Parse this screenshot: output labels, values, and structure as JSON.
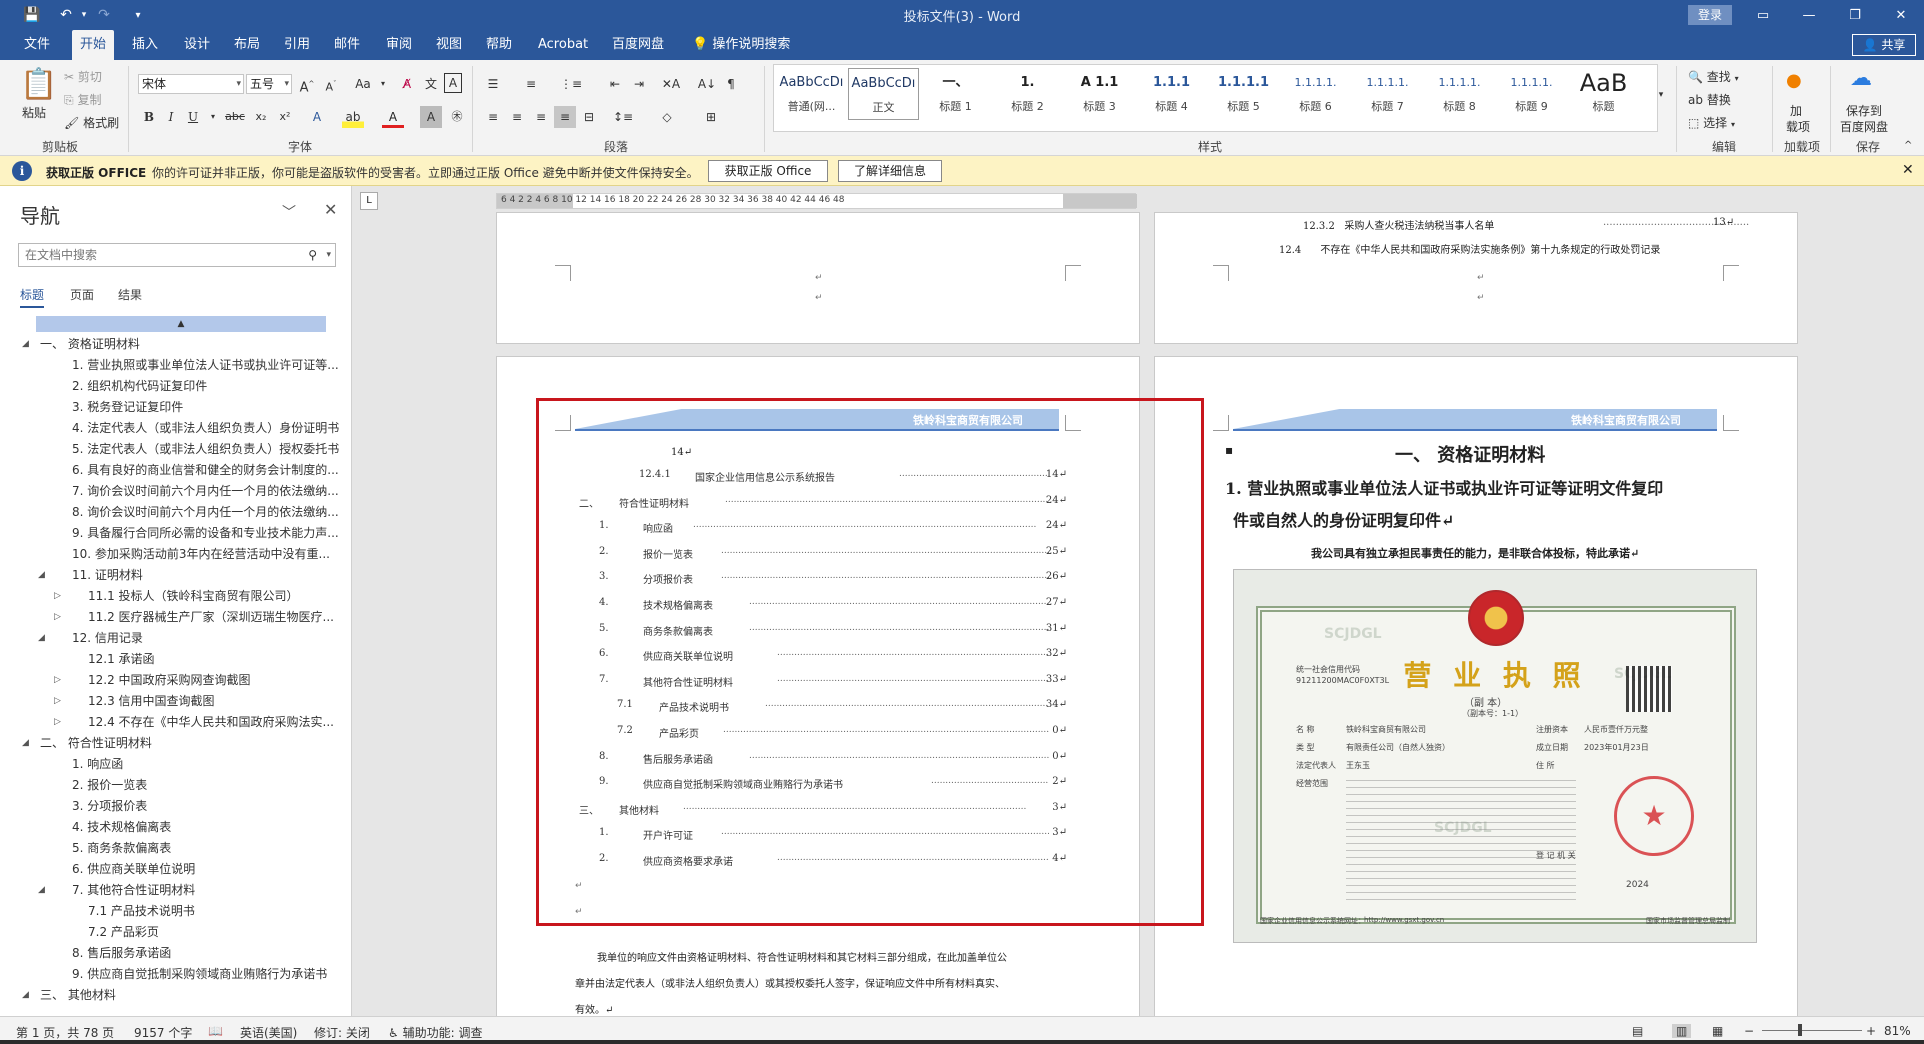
{
  "window": {
    "title": "投标文件(3)  -  Word",
    "login_label": "登录"
  },
  "tabs": [
    "文件",
    "开始",
    "插入",
    "设计",
    "布局",
    "引用",
    "邮件",
    "审阅",
    "视图",
    "帮助",
    "Acrobat",
    "百度网盘"
  ],
  "active_tab": "开始",
  "tell_me": "操作说明搜索",
  "share_label": "共享",
  "ribbon": {
    "clipboard": {
      "paste": "粘贴",
      "cut": "剪切",
      "copy": "复制",
      "format_painter": "格式刷",
      "label": "剪贴板"
    },
    "font": {
      "name": "宋体",
      "size": "五号",
      "label": "字体"
    },
    "paragraph": {
      "label": "段落"
    },
    "styles": {
      "label": "样式",
      "items": [
        {
          "sample": "AaBbCcDı",
          "name": "普通(网..."
        },
        {
          "sample": "AaBbCcDı",
          "name": "正文"
        },
        {
          "sample": "一、",
          "name": "标题 1"
        },
        {
          "sample": "1.",
          "name": "标题 2"
        },
        {
          "sample": "A 1.1",
          "name": "标题 3"
        },
        {
          "sample": "1.1.1",
          "name": "标题 4"
        },
        {
          "sample": "1.1.1.1",
          "name": "标题 5"
        },
        {
          "sample": "1.1.1.1.",
          "name": "标题 6"
        },
        {
          "sample": "1.1.1.1.",
          "name": "标题 7"
        },
        {
          "sample": "1.1.1.1.",
          "name": "标题 8"
        },
        {
          "sample": "1.1.1.1.",
          "name": "标题 9"
        },
        {
          "sample": "AaB",
          "name": "标题"
        }
      ],
      "selected": "正文"
    },
    "editing": {
      "find": "查找",
      "replace": "替换",
      "select": "选择",
      "label": "编辑"
    },
    "addins": {
      "label1": "加",
      "label2": "载项",
      "group": "加载项"
    },
    "save": {
      "label1": "保存到",
      "label2": "百度网盘",
      "group": "保存"
    }
  },
  "warning": {
    "title": "获取正版 OFFICE",
    "message": "你的许可证并非正版，你可能是盗版软件的受害者。立即通过正版 Office 避免中断并使文件保持安全。",
    "btn_get": "获取正版 Office",
    "btn_learn": "了解详细信息"
  },
  "nav": {
    "title": "导航",
    "search_placeholder": "在文档中搜索",
    "tabs": [
      "标题",
      "页面",
      "结果"
    ],
    "items": [
      {
        "level": 0,
        "expanded": true,
        "text": "一、 资格证明材料"
      },
      {
        "level": 1,
        "expanded": null,
        "text": "1. 营业执照或事业单位法人证书或执业许可证等..."
      },
      {
        "level": 1,
        "expanded": null,
        "text": "2. 组织机构代码证复印件"
      },
      {
        "level": 1,
        "expanded": null,
        "text": "3. 税务登记证复印件"
      },
      {
        "level": 1,
        "expanded": null,
        "text": "4. 法定代表人（或非法人组织负责人）身份证明书"
      },
      {
        "level": 1,
        "expanded": null,
        "text": "5. 法定代表人（或非法人组织负责人）授权委托书"
      },
      {
        "level": 1,
        "expanded": null,
        "text": "6. 具有良好的商业信誉和健全的财务会计制度的..."
      },
      {
        "level": 1,
        "expanded": null,
        "text": "7. 询价会议时间前六个月内任一个月的依法缴纳..."
      },
      {
        "level": 1,
        "expanded": null,
        "text": "8. 询价会议时间前六个月内任一个月的依法缴纳..."
      },
      {
        "level": 1,
        "expanded": null,
        "text": "9. 具备履行合同所必需的设备和专业技术能力声..."
      },
      {
        "level": 1,
        "expanded": null,
        "text": "10. 参加采购活动前3年内在经营活动中没有重..."
      },
      {
        "level": 1,
        "expanded": true,
        "text": "11. 证明材料"
      },
      {
        "level": 2,
        "expanded": false,
        "text": "11.1 投标人（铁岭科宝商贸有限公司）"
      },
      {
        "level": 2,
        "expanded": false,
        "text": "11.2 医疗器械生产厂家（深圳迈瑞生物医疗..."
      },
      {
        "level": 1,
        "expanded": true,
        "text": "12. 信用记录"
      },
      {
        "level": 2,
        "expanded": null,
        "text": "12.1 承诺函"
      },
      {
        "level": 2,
        "expanded": false,
        "text": "12.2 中国政府采购网查询截图"
      },
      {
        "level": 2,
        "expanded": false,
        "text": "12.3 信用中国查询截图"
      },
      {
        "level": 2,
        "expanded": false,
        "text": "12.4 不存在《中华人民共和国政府采购法实..."
      },
      {
        "level": 0,
        "expanded": true,
        "text": "二、 符合性证明材料"
      },
      {
        "level": 1,
        "expanded": null,
        "text": "1. 响应函"
      },
      {
        "level": 1,
        "expanded": null,
        "text": "2. 报价一览表"
      },
      {
        "level": 1,
        "expanded": null,
        "text": "3. 分项报价表"
      },
      {
        "level": 1,
        "expanded": null,
        "text": "4. 技术规格偏离表"
      },
      {
        "level": 1,
        "expanded": null,
        "text": "5. 商务条款偏离表"
      },
      {
        "level": 1,
        "expanded": null,
        "text": "6. 供应商关联单位说明"
      },
      {
        "level": 1,
        "expanded": true,
        "text": "7. 其他符合性证明材料"
      },
      {
        "level": 2,
        "expanded": null,
        "text": "7.1 产品技术说明书"
      },
      {
        "level": 2,
        "expanded": null,
        "text": "7.2 产品彩页"
      },
      {
        "level": 1,
        "expanded": null,
        "text": "8. 售后服务承诺函"
      },
      {
        "level": 1,
        "expanded": null,
        "text": "9. 供应商自觉抵制采购领域商业贿赂行为承诺书"
      },
      {
        "level": 0,
        "expanded": true,
        "text": "三、 其他材料"
      }
    ]
  },
  "ruler": {
    "numbers": "6  4  2  2  4  6  8  10  12  14  16  18  20  22  24  26  28  30  32  34  36  38  40  42  44  46  48"
  },
  "doc": {
    "p1": {
      "mark": "↵"
    },
    "p2": {
      "line1_num": "12.3.2",
      "line1_text": "采购人查火税违法纳税当事人名单",
      "line1_page": "13↵",
      "line2_num": "12.4",
      "line2_text": "不存在《中华人民共和国政府采购法实施条例》第十九条规定的行政处罚记录",
      "mark": "↵"
    },
    "company": "铁岭科宝商贸有限公司",
    "p3": {
      "top_page": "14↵",
      "toc": [
        {
          "num": "12.4.1",
          "text": "国家企业信用信息公示系统报告",
          "page": "14↵",
          "indent": 2
        },
        {
          "num": "二、",
          "text": "符合性证明材料",
          "page": "24↵",
          "indent": 0
        },
        {
          "num": "1.",
          "text": "响应函",
          "page": "24↵",
          "indent": 1
        },
        {
          "num": "2.",
          "text": "报价一览表",
          "page": "25↵",
          "indent": 1
        },
        {
          "num": "3.",
          "text": "分项报价表",
          "page": "26↵",
          "indent": 1
        },
        {
          "num": "4.",
          "text": "技术规格偏离表",
          "page": "27↵",
          "indent": 1
        },
        {
          "num": "5.",
          "text": "商务条款偏离表",
          "page": "31↵",
          "indent": 1
        },
        {
          "num": "6.",
          "text": "供应商关联单位说明",
          "page": "32↵",
          "indent": 1
        },
        {
          "num": "7.",
          "text": "其他符合性证明材料",
          "page": "33↵",
          "indent": 1
        },
        {
          "num": "7.1",
          "text": "产品技术说明书",
          "page": "34↵",
          "indent": 2
        },
        {
          "num": "7.2",
          "text": "产品彩页",
          "page": "0↵",
          "indent": 2
        },
        {
          "num": "8.",
          "text": "售后服务承诺函",
          "page": "0↵",
          "indent": 1
        },
        {
          "num": "9.",
          "text": "供应商自觉抵制采购领域商业贿赂行为承诺书",
          "page": "2↵",
          "indent": 1
        },
        {
          "num": "三、",
          "text": "其他材料",
          "page": "3↵",
          "indent": 0
        },
        {
          "num": "1.",
          "text": "开户许可证",
          "page": "3↵",
          "indent": 1
        },
        {
          "num": "2.",
          "text": "供应商资格要求承诺",
          "page": "4↵",
          "indent": 1
        }
      ],
      "para1": "我单位的响应文件由资格证明材料、符合性证明材料和其它材料三部分组成，在此加盖单位公",
      "para2": "章并由法定代表人（或非法人组织负责人）或其授权委托人签字，保证响应文件中所有材料真实、",
      "para3": "有效。↵"
    },
    "p4": {
      "heading": "一、 资格证明材料",
      "sub1": "1. 营业执照或事业单位法人证书或执业许可证等证明文件复印",
      "sub2": "件或自然人的身份证明复印件↵",
      "note": "我公司具有独立承担民事责任的能力，是非联合体投标，特此承诺↵",
      "license": {
        "title": "营 业 执 照",
        "subtitle": "（副  本）",
        "copy_no": "（副本号：1-1）",
        "credit_code_label": "统一社会信用代码",
        "credit_code": "91211200MAC0F0XT3L",
        "name_label": "名        称",
        "name": "铁岭科宝商贸有限公司",
        "type_label": "类        型",
        "type": "有限责任公司（自然人独资）",
        "rep_label": "法定代表人",
        "rep": "王东玉",
        "scope_label": "经营范围",
        "capital_label": "注册资本",
        "capital": "人民币壹仟万元整",
        "date_label": "成立日期",
        "date": "2023年01月23日",
        "addr_label": "住        所",
        "reg_label": "登 记 机 关",
        "year": "2024",
        "footer_left": "国家企业信用信息公示系统网址：",
        "footer_url": "http://www.gsxt.gov.cn",
        "footer_right": "国家市场监督管理总局监制"
      }
    }
  },
  "status": {
    "page": "第 1 页，共 78 页",
    "words": "9157 个字",
    "lang": "英语(美国)",
    "revision": "修订: 关闭",
    "accessibility": "辅助功能: 调查",
    "zoom": "81%"
  }
}
